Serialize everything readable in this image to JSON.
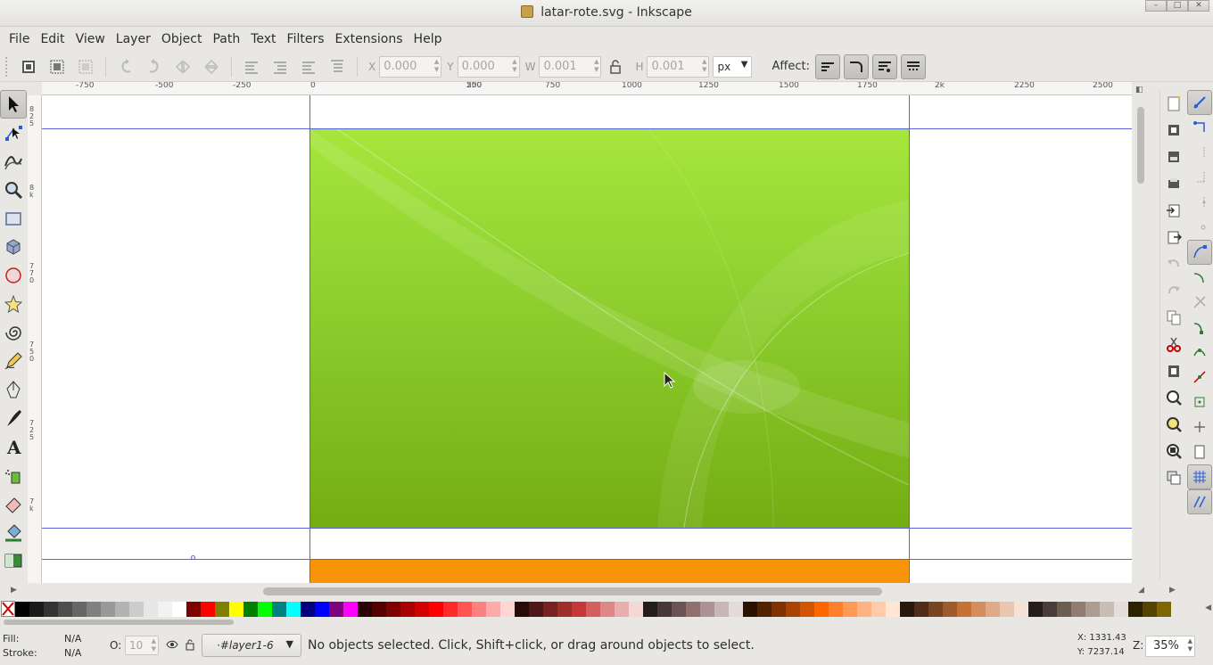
{
  "window": {
    "title": "latar-rote.svg - Inkscape",
    "controls": [
      "–",
      "□",
      "✕"
    ]
  },
  "menu": [
    "File",
    "Edit",
    "View",
    "Layer",
    "Object",
    "Path",
    "Text",
    "Filters",
    "Extensions",
    "Help"
  ],
  "toolbar": {
    "x_label": "X",
    "x_value": "0.000",
    "y_label": "Y",
    "y_value": "0.000",
    "w_label": "W",
    "w_value": "0.001",
    "h_label": "H",
    "h_value": "0.001",
    "unit": "px",
    "affect_label": "Affect:"
  },
  "ruler": {
    "h_ticks": [
      "-750",
      "-500",
      "-250",
      "0",
      "250",
      "500",
      "750",
      "1000",
      "1250",
      "1500",
      "1750",
      "2k",
      "2250",
      "2500"
    ],
    "v_ticks": [
      "8 2 5",
      "8 k",
      "7 7 0",
      "7 5 0",
      "7 2 5",
      "7 k"
    ]
  },
  "statusbar": {
    "fill_label": "Fill:",
    "fill_value": "N/A",
    "stroke_label": "Stroke:",
    "stroke_value": "N/A",
    "opacity_label": "O:",
    "opacity_value": "10",
    "layer": "·#layer1-6",
    "message": "No objects selected. Click, Shift+click, or drag around objects to select.",
    "x_coord": "X: 1331.43",
    "y_coord": "Y: 7237.14",
    "zoom_label": "Z:",
    "zoom_value": "35%"
  },
  "colors": {
    "guide": "#5b63d8",
    "page_green_top": "#a6e63c",
    "page_green_bottom": "#74ad12",
    "page_orange": "#f8940a"
  },
  "palette": [
    "#000000",
    "#1a1a1a",
    "#333333",
    "#4d4d4d",
    "#666666",
    "#808080",
    "#999999",
    "#b3b3b3",
    "#cccccc",
    "#e6e6e6",
    "#f2f2f2",
    "#ffffff",
    "#800000",
    "#ff0000",
    "#808000",
    "#ffff00",
    "#008000",
    "#00ff00",
    "#008080",
    "#00ffff",
    "#000080",
    "#0000ff",
    "#800080",
    "#ff00ff",
    "#2b0000",
    "#550000",
    "#800000",
    "#aa0000",
    "#d40000",
    "#ff0000",
    "#ff2a2a",
    "#ff5555",
    "#ff8080",
    "#ffaaaa",
    "#ffd5d5",
    "#280b0b",
    "#501616",
    "#782121",
    "#a02c2c",
    "#c83737",
    "#d35f5f",
    "#de8787",
    "#e9afaf",
    "#f4d7d7",
    "#241c1c",
    "#483737",
    "#6c5353",
    "#916f6f",
    "#ac9393",
    "#c8b7b7",
    "#e3dbdb",
    "#2b1100",
    "#552200",
    "#803300",
    "#aa4400",
    "#d45500",
    "#ff6600",
    "#ff7f2a",
    "#ff9955",
    "#ffb380",
    "#ffccaa",
    "#ffe6d5",
    "#28170b",
    "#502d16",
    "#784421",
    "#a05a2c",
    "#c87137",
    "#d38d5f",
    "#deaa87",
    "#e9c6af",
    "#f4e3d7",
    "#241f1c",
    "#483e37",
    "#6c5d53",
    "#917c6f",
    "#ac9d93",
    "#c8beb7",
    "#e3dedb",
    "#2b2200",
    "#554400",
    "#806600"
  ]
}
